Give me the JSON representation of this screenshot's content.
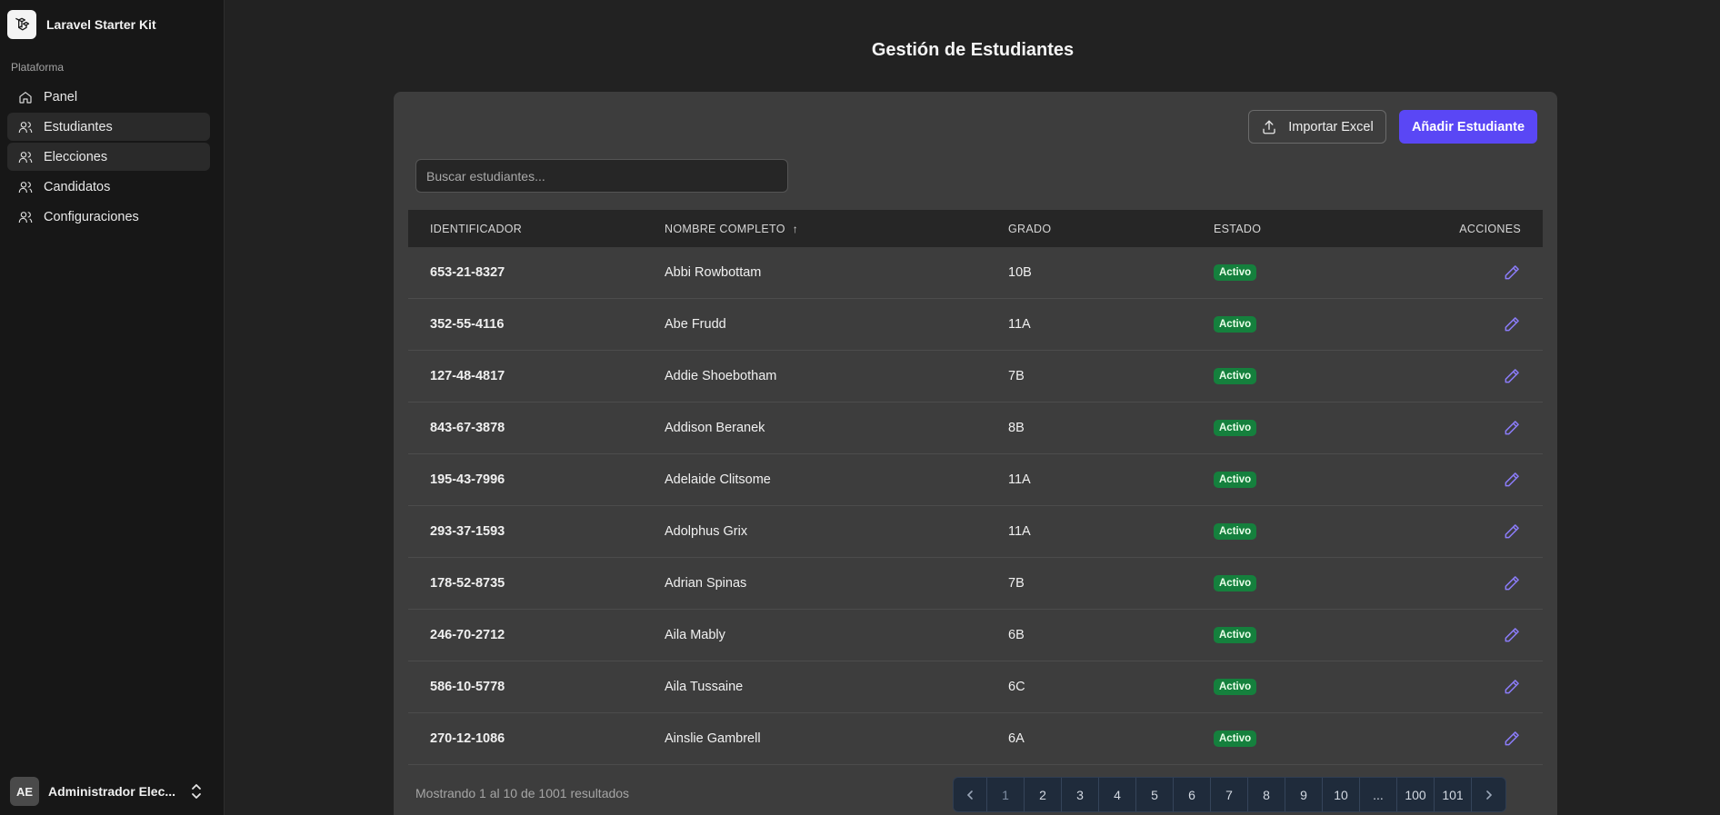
{
  "sidebar": {
    "brand": "Laravel Starter Kit",
    "group_label": "Plataforma",
    "items": [
      {
        "label": "Panel",
        "icon": "home-icon"
      },
      {
        "label": "Estudiantes",
        "icon": "users-icon"
      },
      {
        "label": "Elecciones",
        "icon": "users-icon"
      },
      {
        "label": "Candidatos",
        "icon": "users-icon"
      },
      {
        "label": "Configuraciones",
        "icon": "users-icon"
      }
    ],
    "user": {
      "initials": "AE",
      "name": "Administrador Elec..."
    }
  },
  "page": {
    "title": "Gestión de Estudiantes"
  },
  "toolbar": {
    "import_label": "Importar Excel",
    "add_label": "Añadir Estudiante",
    "search_placeholder": "Buscar estudiantes..."
  },
  "table": {
    "headers": [
      "IDENTIFICADOR",
      "NOMBRE COMPLETO",
      "GRADO",
      "ESTADO",
      "ACCIONES"
    ],
    "rows": [
      {
        "id": "653-21-8327",
        "name": "Abbi Rowbottam",
        "grade": "10B",
        "status": "Activo"
      },
      {
        "id": "352-55-4116",
        "name": "Abe Frudd",
        "grade": "11A",
        "status": "Activo"
      },
      {
        "id": "127-48-4817",
        "name": "Addie Shoebotham",
        "grade": "7B",
        "status": "Activo"
      },
      {
        "id": "843-67-3878",
        "name": "Addison Beranek",
        "grade": "8B",
        "status": "Activo"
      },
      {
        "id": "195-43-7996",
        "name": "Adelaide Clitsome",
        "grade": "11A",
        "status": "Activo"
      },
      {
        "id": "293-37-1593",
        "name": "Adolphus Grix",
        "grade": "11A",
        "status": "Activo"
      },
      {
        "id": "178-52-8735",
        "name": "Adrian Spinas",
        "grade": "7B",
        "status": "Activo"
      },
      {
        "id": "246-70-2712",
        "name": "Aila Mably",
        "grade": "6B",
        "status": "Activo"
      },
      {
        "id": "586-10-5778",
        "name": "Aila Tussaine",
        "grade": "6C",
        "status": "Activo"
      },
      {
        "id": "270-12-1086",
        "name": "Ainslie Gambrell",
        "grade": "6A",
        "status": "Activo"
      }
    ]
  },
  "footer": {
    "summary": "Mostrando 1 al 10 de 1001 resultados",
    "pages": [
      "1",
      "2",
      "3",
      "4",
      "5",
      "6",
      "7",
      "8",
      "9",
      "10",
      "...",
      "100",
      "101"
    ],
    "current_page": "1"
  },
  "colors": {
    "accent": "#5a47f5",
    "badge": "#15803d",
    "edit_icon": "#8b7cf8"
  }
}
